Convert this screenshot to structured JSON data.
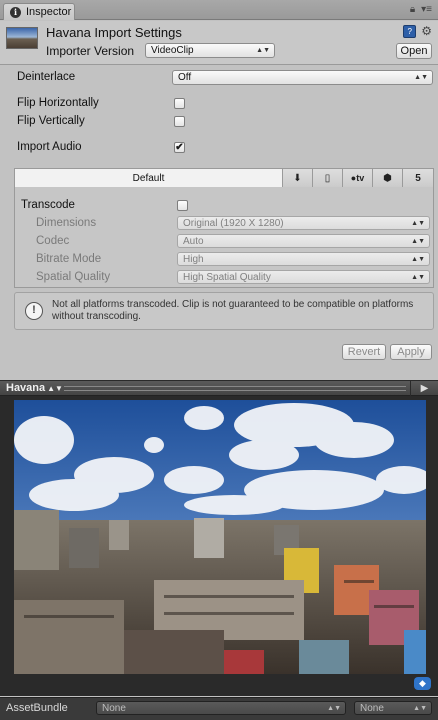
{
  "tab": {
    "title": "Inspector",
    "lock_icon": "lock-icon",
    "menu_icon": "menu-icon"
  },
  "header": {
    "title": "Havana Import Settings",
    "importer_version_label": "Importer Version",
    "importer_version_value": "VideoClip",
    "open_label": "Open"
  },
  "settings": {
    "deinterlace_label": "Deinterlace",
    "deinterlace_value": "Off",
    "flip_h_label": "Flip Horizontally",
    "flip_h_checked": false,
    "flip_v_label": "Flip Vertically",
    "flip_v_checked": false,
    "import_audio_label": "Import Audio",
    "import_audio_checked": true
  },
  "platform_tabs": {
    "default_label": "Default",
    "icons": [
      "download-icon",
      "phone-icon",
      "appletv-icon",
      "android-icon",
      "html5-icon"
    ]
  },
  "transcode": {
    "label": "Transcode",
    "checked": false,
    "dimensions_label": "Dimensions",
    "dimensions_value": "Original (1920 X 1280)",
    "codec_label": "Codec",
    "codec_value": "Auto",
    "bitrate_label": "Bitrate Mode",
    "bitrate_value": "High",
    "quality_label": "Spatial Quality",
    "quality_value": "High Spatial Quality"
  },
  "warning": {
    "text": "Not all platforms transcoded. Clip is not guaranteed to be compatible on platforms without transcoding."
  },
  "actions": {
    "revert_label": "Revert",
    "apply_label": "Apply"
  },
  "preview": {
    "title": "Havana"
  },
  "asset_bundle": {
    "label": "AssetBundle",
    "name_value": "None",
    "variant_value": "None"
  }
}
